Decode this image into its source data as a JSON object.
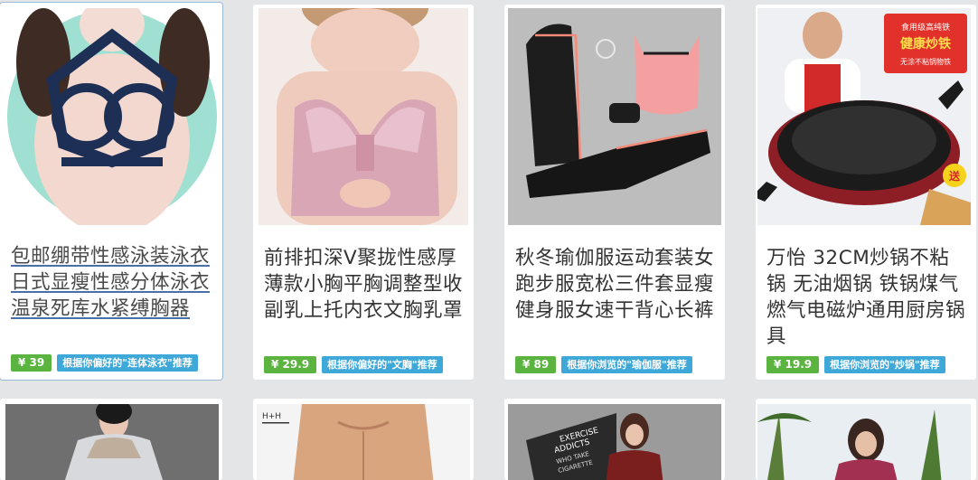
{
  "products": [
    {
      "title": "包邮绷带性感泳装泳衣日式显瘦性感分体泳衣温泉死库水紧缚胸器",
      "price": "¥ 39",
      "reason": "根据你偏好的\"连体泳衣\"推荐"
    },
    {
      "title": "前排扣深V聚拢性感厚薄款小胸平胸调整型收副乳上托内衣文胸乳罩",
      "price": "¥ 29.9",
      "reason": "根据你偏好的\"文胸\"推荐"
    },
    {
      "title": "秋冬瑜伽服运动套装女跑步服宽松三件套显瘦健身服女速干背心长裤",
      "price": "¥ 89",
      "reason": "根据你浏览的\"瑜伽服\"推荐"
    },
    {
      "title": "万怡 32CM炒锅不粘锅 无油烟锅 铁锅煤气燃气电磁炉通用厨房锅具",
      "price": "¥ 19.9",
      "reason": "根据你浏览的\"炒锅\"推荐"
    }
  ],
  "image_text": {
    "wok_ad_line1": "食用级高纯铁",
    "wok_ad_line2": "健康炒铁",
    "wok_ad_line3": "无涂不粘锅物铁",
    "wok_badge": "送",
    "barcode_text": "H+H",
    "poster_line1": "EXERCISE",
    "poster_line2": "ADDICTS",
    "poster_line3": "WHO TAKE",
    "poster_line4": "CIGARETTE"
  }
}
